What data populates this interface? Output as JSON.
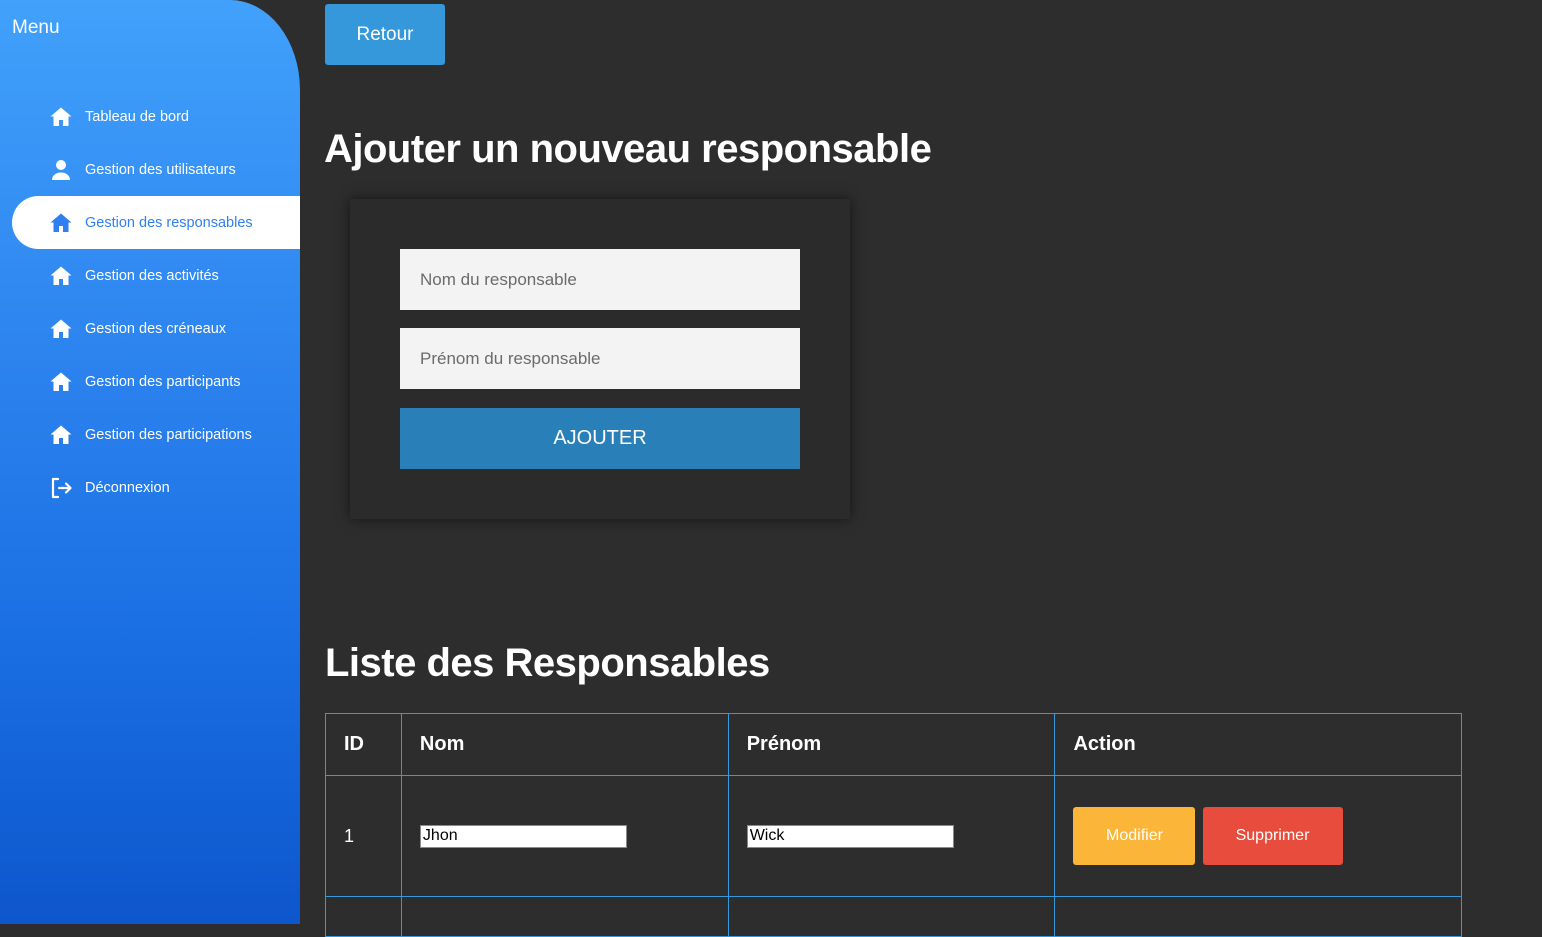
{
  "sidebar": {
    "title": "Menu",
    "items": [
      {
        "label": "Tableau de bord",
        "icon": "home-icon"
      },
      {
        "label": "Gestion des utilisateurs",
        "icon": "user-icon"
      },
      {
        "label": "Gestion des responsables",
        "icon": "home-icon",
        "active": true
      },
      {
        "label": "Gestion des activités",
        "icon": "home-icon"
      },
      {
        "label": "Gestion des créneaux",
        "icon": "home-icon"
      },
      {
        "label": "Gestion des participants",
        "icon": "home-icon"
      },
      {
        "label": "Gestion des participations",
        "icon": "home-icon"
      },
      {
        "label": "Déconnexion",
        "icon": "logout-icon"
      }
    ]
  },
  "back_button": "Retour",
  "add_section": {
    "title": "Ajouter un nouveau responsable",
    "nom_placeholder": "Nom du responsable",
    "prenom_placeholder": "Prénom du responsable",
    "submit_label": "AJOUTER"
  },
  "list_section": {
    "title": "Liste des Responsables",
    "headers": [
      "ID",
      "Nom",
      "Prénom",
      "Action"
    ],
    "rows": [
      {
        "id": "1",
        "nom": "Jhon",
        "prenom": "Wick",
        "modify_label": "Modifier",
        "delete_label": "Supprimer"
      }
    ]
  },
  "colors": {
    "accent": "#3498db",
    "active_text": "#2f7ff0",
    "modify": "#fbb63a",
    "delete": "#e74c3c",
    "background": "#2d2d2d"
  }
}
